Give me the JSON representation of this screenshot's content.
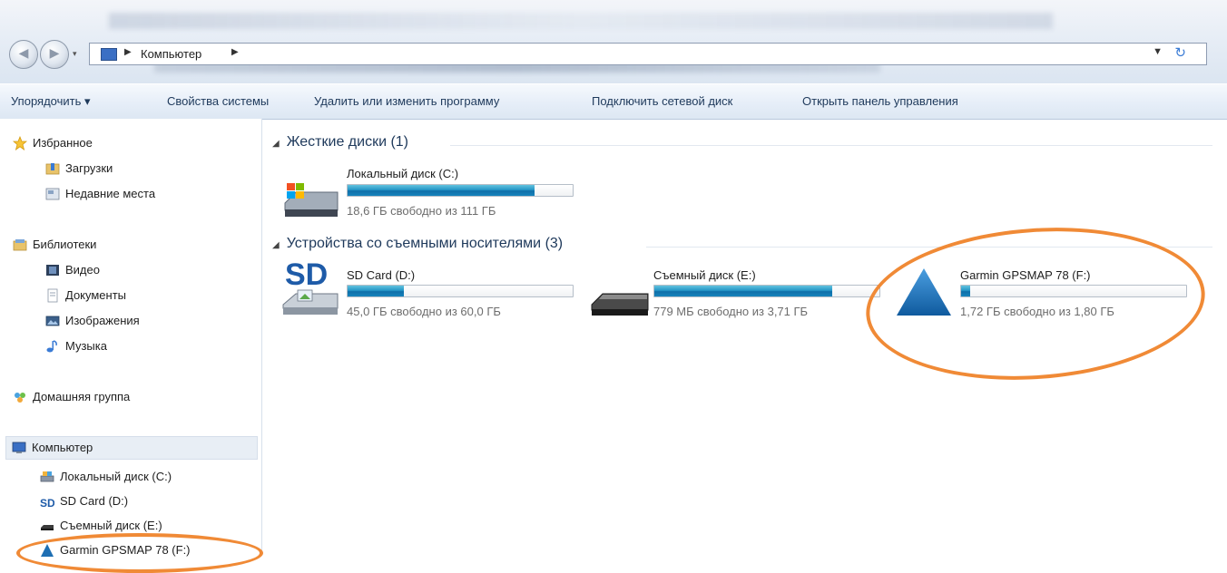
{
  "address_bar": {
    "crumbs": [
      "Компьютер"
    ]
  },
  "toolbar": {
    "organize": "Упорядочить ▾",
    "system_properties": "Свойства системы",
    "uninstall": "Удалить или изменить программу",
    "map_drive": "Подключить сетевой диск",
    "control_panel": "Открыть панель управления"
  },
  "sidebar": {
    "favorites": {
      "label": "Избранное",
      "items": [
        "Загрузки",
        "Недавние места"
      ]
    },
    "libraries": {
      "label": "Библиотеки",
      "items": [
        "Видео",
        "Документы",
        "Изображения",
        "Музыка"
      ]
    },
    "homegroup": "Домашняя группа",
    "computer": {
      "label": "Компьютер",
      "items": [
        "Локальный диск (C:)",
        "SD Card (D:)",
        "Съемный диск (E:)",
        "Garmin GPSMAP 78 (F:)"
      ]
    }
  },
  "main": {
    "hard_disks": {
      "header": "Жесткие диски (1)",
      "drives": [
        {
          "name": "Локальный диск (C:)",
          "space": "18,6 ГБ свободно из 111 ГБ",
          "used_fraction": 0.83
        }
      ]
    },
    "removable": {
      "header": "Устройства со съемными носителями (3)",
      "drives": [
        {
          "name": "SD Card (D:)",
          "space": "45,0 ГБ свободно из 60,0 ГБ",
          "used_fraction": 0.25,
          "icon_text": "SD"
        },
        {
          "name": "Съемный диск (E:)",
          "space": "779 МБ свободно из 3,71 ГБ",
          "used_fraction": 0.79
        },
        {
          "name": "Garmin GPSMAP 78 (F:)",
          "space": "1,72 ГБ свободно из 1,80 ГБ",
          "used_fraction": 0.04
        }
      ]
    }
  },
  "colors": {
    "highlight": "#f08a36",
    "bar": "#2596c7",
    "garmin": "#1e6fb3"
  }
}
